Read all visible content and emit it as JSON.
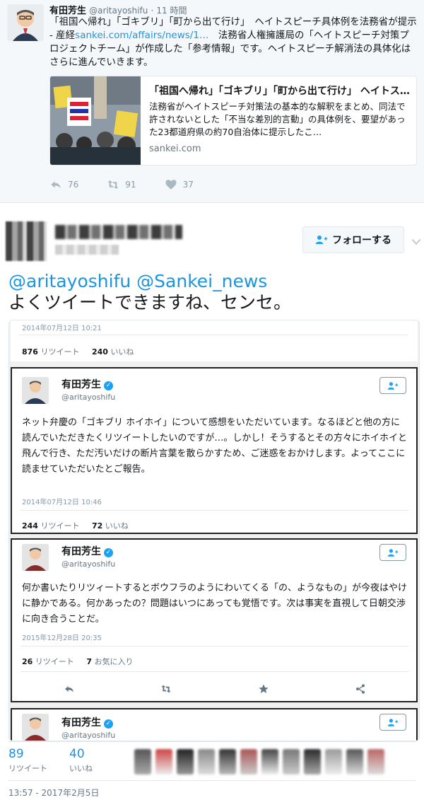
{
  "top_tweet": {
    "name": "有田芳生",
    "handle": "@aritayoshifu",
    "time": "11 時間",
    "text_before_link": "「祖国へ帰れ」「ゴキブリ」「町から出て行け」　ヘイトスピーチ具体例を法務省が提示 - 産経",
    "link": "sankei.com/affairs/news/1…",
    "text_after_link": "　法務省人権擁護局の「ヘイトスピーチ対策プロジェクトチーム」が作成した「参考情報」です。ヘイトスピーチ解消法の具体化はさらに進んでいきます。",
    "card": {
      "title": "「祖国へ帰れ」「ゴキブリ」「町から出て行け」 ヘイトス…",
      "description": "法務省がヘイトスピーチ対策法の基本的な解釈をまとめ、同法で許されないとした「不当な差別的言動」の具体例を、要望があった23都道府県の約70自治体に提示したこ…",
      "domain": "sankei.com"
    },
    "actions": {
      "reply": "76",
      "retweet": "91",
      "like": "37"
    }
  },
  "main_tweet": {
    "follow_label": "フォローする",
    "mentions": [
      "@aritayoshifu",
      "@Sankei_news"
    ],
    "text": "よくツイートできますね、センセ。"
  },
  "screenshots": {
    "shot1": {
      "date": "2014年07月12日 10:21",
      "retweets": "876",
      "retweets_label": "リツイート",
      "likes": "240",
      "likes_label": "いいね"
    },
    "shot2": {
      "name": "有田芳生",
      "handle": "@aritayoshifu",
      "text": "ネット弁慶の「ゴキブリ ホイホイ」について感想をいただいています。なるほどと他の方に読んでいただきたくリツイートしたいのですが…。しかし！そうするとその方々にホイホイと飛んで行き、ただ汚いだけの断片言葉を散らかすため、ご迷惑をおかけします。よってここに読ませていただいたとご報告。",
      "date": "2014年07月12日 10:46",
      "retweets": "244",
      "retweets_label": "リツイート",
      "likes": "72",
      "likes_label": "いいね"
    },
    "shot3": {
      "name": "有田芳生",
      "handle": "@aritayoshifu",
      "text": "何か書いたりリツィートするとボウフラのようにわいてくる「の、ようなもの」が今夜はやけに静かである。何かあったの？問題はいつにあっても覚悟です。次は事実を直視して日朝交渉に向き合うことだ。",
      "date": "2015年12月28日 20:35",
      "retweets": "26",
      "retweets_label": "リツイート",
      "likes": "7",
      "likes_label": "お気に入り"
    },
    "shot4": {
      "name": "有田芳生",
      "handle": "@aritayoshifu"
    }
  },
  "stats": {
    "retweets": "89",
    "retweets_label": "リツイート",
    "likes": "40",
    "likes_label": "いいね"
  },
  "timestamp": "13:57 - 2017年2月5日",
  "colors": {
    "link": "#1b95e0",
    "verified": "#1da1f2",
    "muted": "#657786"
  }
}
